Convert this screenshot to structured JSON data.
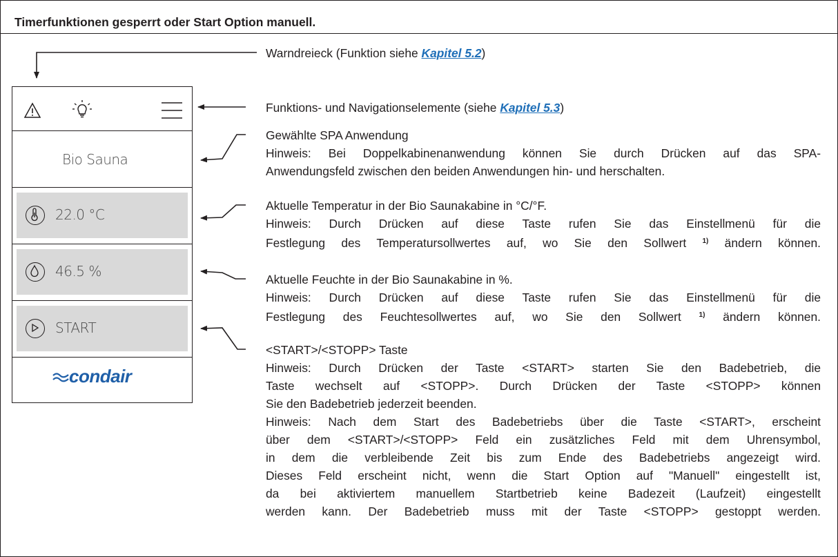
{
  "header": {
    "title": "Timerfunktionen gesperrt oder Start Option manuell."
  },
  "device": {
    "app_name": "Bio Sauna",
    "temperature": "22.0 °C",
    "humidity": "46.5 %",
    "start_label": "START",
    "logo_text": "condair",
    "icons": [
      "warning-triangle-icon",
      "light-bulb-icon",
      "menu-icon",
      "thermometer-icon",
      "droplet-icon",
      "play-icon"
    ]
  },
  "annotations": {
    "warn": {
      "text": "Warndreieck (Funktion siehe ",
      "link": "Kapitel 5.2",
      "end": ")"
    },
    "nav": {
      "text": "Funktions- und Navigationselemente (siehe ",
      "link": "Kapitel 5.3",
      "end": ")"
    },
    "spa": {
      "line1": "Gewählte SPA Anwendung",
      "line2": "Hinweis: Bei Doppelkabinenanwendung können Sie durch Drücken auf das SPA-",
      "line3": "Anwendungsfeld zwischen den beiden Anwendungen hin- und herschalten."
    },
    "temp": {
      "line1": "Aktuelle Temperatur in der Bio Saunakabine in °C/°F.",
      "line2": "Hinweis: Durch Drücken auf diese Taste rufen Sie das Einstellmenü für die",
      "line3a": "Festlegung des Temperatursollwertes auf, wo Sie den Sollwert ",
      "sup": "1)",
      "line3b": " ändern können."
    },
    "hum": {
      "line1": "Aktuelle Feuchte in der Bio Saunakabine in %.",
      "line2": "Hinweis: Durch Drücken auf diese Taste rufen Sie das Einstellmenü für die",
      "line3a": "Festlegung des Feuchtesollwertes auf, wo Sie den Sollwert ",
      "sup": "1)",
      "line3b": " ändern können."
    },
    "start": {
      "line1": "<START>/<STOPP> Taste",
      "lines": [
        "Hinweis: Durch Drücken der Taste <START> starten Sie den Badebetrieb, die",
        "Taste wechselt auf <STOPP>. Durch Drücken der Taste <STOPP> können",
        "Sie den Badebetrieb jederzeit beenden.",
        "Hinweis: Nach dem Start des Badebetriebs über die Taste <START>, erscheint",
        "über dem <START>/<STOPP> Feld ein zusätzliches Feld mit dem Uhrensymbol,",
        "in dem  die verbleibende Zeit bis zum Ende des Badebetriebs angezeigt wird.",
        "Dieses Feld erscheint nicht, wenn die Start Option auf \"Manuell\" eingestellt ist,",
        "da bei aktiviertem manuellem Startbetrieb keine Badezeit (Laufzeit) eingestellt",
        "werden kann. Der Badebetrieb muss mit der Taste <STOPP> gestoppt werden."
      ]
    }
  },
  "colors": {
    "link": "#1f6fb8",
    "grey_field": "#d9d9d9",
    "logo": "#1f5fa8"
  }
}
